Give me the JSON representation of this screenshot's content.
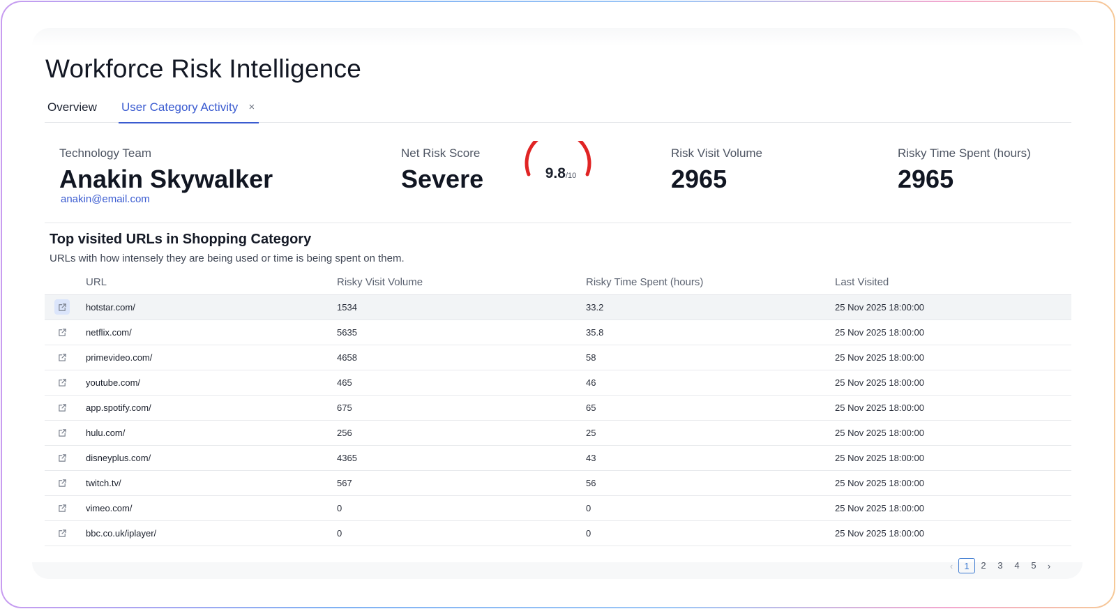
{
  "app": {
    "title": "Workforce Risk Intelligence"
  },
  "tabs": [
    {
      "label": "Overview",
      "active": false
    },
    {
      "label": "User Category Activity",
      "active": true,
      "closable": true
    }
  ],
  "tab_close_glyph": "×",
  "user": {
    "team": "Technology Team",
    "name": "Anakin Skywalker",
    "email": "anakin@email.com"
  },
  "risk": {
    "label": "Net Risk Score",
    "level": "Severe",
    "score": "9.8",
    "score_max": "/10",
    "score_fraction": 0.98,
    "gauge_color": "#e02424"
  },
  "visit_volume": {
    "label": "Risk Visit Volume",
    "value": "2965"
  },
  "time_spent": {
    "label": "Risky Time Spent (hours)",
    "value": "2965"
  },
  "section": {
    "title": "Top visited URLs in Shopping Category",
    "subtitle": "URLs with how intensely they are being used or time is being spent on them."
  },
  "table": {
    "columns": [
      "URL",
      "Risky Visit Volume",
      "Risky Time Spent (hours)",
      "Last Visited"
    ],
    "rows": [
      {
        "url": "hotstar.com/",
        "volume": "1534",
        "time": "33.2",
        "last": "25 Nov 2025 18:00:00",
        "selected": true
      },
      {
        "url": "netflix.com/",
        "volume": "5635",
        "time": "35.8",
        "last": "25 Nov 2025 18:00:00"
      },
      {
        "url": "primevideo.com/",
        "volume": "4658",
        "time": "58",
        "last": "25 Nov 2025 18:00:00"
      },
      {
        "url": "youtube.com/",
        "volume": "465",
        "time": "46",
        "last": "25 Nov 2025 18:00:00"
      },
      {
        "url": "app.spotify.com/",
        "volume": "675",
        "time": "65",
        "last": "25 Nov 2025 18:00:00"
      },
      {
        "url": "hulu.com/",
        "volume": "256",
        "time": "25",
        "last": "25 Nov 2025 18:00:00"
      },
      {
        "url": "disneyplus.com/",
        "volume": "4365",
        "time": "43",
        "last": "25 Nov 2025 18:00:00"
      },
      {
        "url": "twitch.tv/",
        "volume": "567",
        "time": "56",
        "last": "25 Nov 2025 18:00:00"
      },
      {
        "url": "vimeo.com/",
        "volume": "0",
        "time": "0",
        "last": "25 Nov 2025 18:00:00"
      },
      {
        "url": "bbc.co.uk/iplayer/",
        "volume": "0",
        "time": "0",
        "last": "25 Nov 2025 18:00:00"
      }
    ],
    "row_icon": "external-link-icon"
  },
  "pagination": {
    "prev_glyph": "‹",
    "next_glyph": "›",
    "pages": [
      "1",
      "2",
      "3",
      "4",
      "5"
    ],
    "current": "1"
  },
  "colors": {
    "accent": "#3a5bd0",
    "severe": "#e02424"
  }
}
